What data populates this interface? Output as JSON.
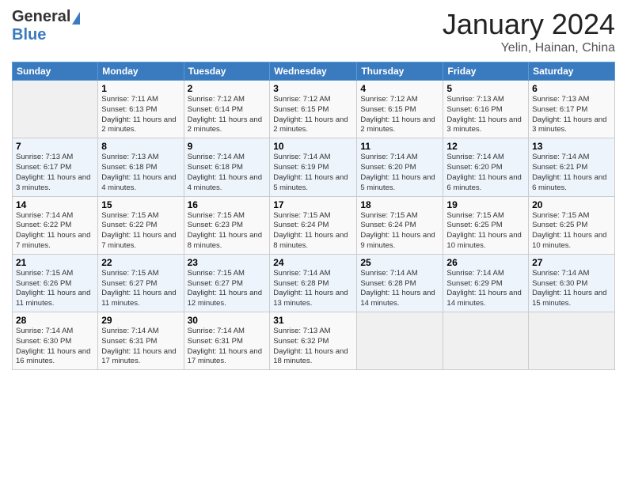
{
  "header": {
    "logo_general": "General",
    "logo_blue": "Blue",
    "month_year": "January 2024",
    "location": "Yelin, Hainan, China"
  },
  "days_of_week": [
    "Sunday",
    "Monday",
    "Tuesday",
    "Wednesday",
    "Thursday",
    "Friday",
    "Saturday"
  ],
  "weeks": [
    [
      {
        "num": "",
        "empty": true
      },
      {
        "num": "1",
        "sunrise": "7:11 AM",
        "sunset": "6:13 PM",
        "daylight": "11 hours and 2 minutes."
      },
      {
        "num": "2",
        "sunrise": "7:12 AM",
        "sunset": "6:14 PM",
        "daylight": "11 hours and 2 minutes."
      },
      {
        "num": "3",
        "sunrise": "7:12 AM",
        "sunset": "6:15 PM",
        "daylight": "11 hours and 2 minutes."
      },
      {
        "num": "4",
        "sunrise": "7:12 AM",
        "sunset": "6:15 PM",
        "daylight": "11 hours and 2 minutes."
      },
      {
        "num": "5",
        "sunrise": "7:13 AM",
        "sunset": "6:16 PM",
        "daylight": "11 hours and 3 minutes."
      },
      {
        "num": "6",
        "sunrise": "7:13 AM",
        "sunset": "6:17 PM",
        "daylight": "11 hours and 3 minutes."
      }
    ],
    [
      {
        "num": "7",
        "sunrise": "7:13 AM",
        "sunset": "6:17 PM",
        "daylight": "11 hours and 3 minutes."
      },
      {
        "num": "8",
        "sunrise": "7:13 AM",
        "sunset": "6:18 PM",
        "daylight": "11 hours and 4 minutes."
      },
      {
        "num": "9",
        "sunrise": "7:14 AM",
        "sunset": "6:18 PM",
        "daylight": "11 hours and 4 minutes."
      },
      {
        "num": "10",
        "sunrise": "7:14 AM",
        "sunset": "6:19 PM",
        "daylight": "11 hours and 5 minutes."
      },
      {
        "num": "11",
        "sunrise": "7:14 AM",
        "sunset": "6:20 PM",
        "daylight": "11 hours and 5 minutes."
      },
      {
        "num": "12",
        "sunrise": "7:14 AM",
        "sunset": "6:20 PM",
        "daylight": "11 hours and 6 minutes."
      },
      {
        "num": "13",
        "sunrise": "7:14 AM",
        "sunset": "6:21 PM",
        "daylight": "11 hours and 6 minutes."
      }
    ],
    [
      {
        "num": "14",
        "sunrise": "7:14 AM",
        "sunset": "6:22 PM",
        "daylight": "11 hours and 7 minutes."
      },
      {
        "num": "15",
        "sunrise": "7:15 AM",
        "sunset": "6:22 PM",
        "daylight": "11 hours and 7 minutes."
      },
      {
        "num": "16",
        "sunrise": "7:15 AM",
        "sunset": "6:23 PM",
        "daylight": "11 hours and 8 minutes."
      },
      {
        "num": "17",
        "sunrise": "7:15 AM",
        "sunset": "6:24 PM",
        "daylight": "11 hours and 8 minutes."
      },
      {
        "num": "18",
        "sunrise": "7:15 AM",
        "sunset": "6:24 PM",
        "daylight": "11 hours and 9 minutes."
      },
      {
        "num": "19",
        "sunrise": "7:15 AM",
        "sunset": "6:25 PM",
        "daylight": "11 hours and 10 minutes."
      },
      {
        "num": "20",
        "sunrise": "7:15 AM",
        "sunset": "6:25 PM",
        "daylight": "11 hours and 10 minutes."
      }
    ],
    [
      {
        "num": "21",
        "sunrise": "7:15 AM",
        "sunset": "6:26 PM",
        "daylight": "11 hours and 11 minutes."
      },
      {
        "num": "22",
        "sunrise": "7:15 AM",
        "sunset": "6:27 PM",
        "daylight": "11 hours and 11 minutes."
      },
      {
        "num": "23",
        "sunrise": "7:15 AM",
        "sunset": "6:27 PM",
        "daylight": "11 hours and 12 minutes."
      },
      {
        "num": "24",
        "sunrise": "7:14 AM",
        "sunset": "6:28 PM",
        "daylight": "11 hours and 13 minutes."
      },
      {
        "num": "25",
        "sunrise": "7:14 AM",
        "sunset": "6:28 PM",
        "daylight": "11 hours and 14 minutes."
      },
      {
        "num": "26",
        "sunrise": "7:14 AM",
        "sunset": "6:29 PM",
        "daylight": "11 hours and 14 minutes."
      },
      {
        "num": "27",
        "sunrise": "7:14 AM",
        "sunset": "6:30 PM",
        "daylight": "11 hours and 15 minutes."
      }
    ],
    [
      {
        "num": "28",
        "sunrise": "7:14 AM",
        "sunset": "6:30 PM",
        "daylight": "11 hours and 16 minutes."
      },
      {
        "num": "29",
        "sunrise": "7:14 AM",
        "sunset": "6:31 PM",
        "daylight": "11 hours and 17 minutes."
      },
      {
        "num": "30",
        "sunrise": "7:14 AM",
        "sunset": "6:31 PM",
        "daylight": "11 hours and 17 minutes."
      },
      {
        "num": "31",
        "sunrise": "7:13 AM",
        "sunset": "6:32 PM",
        "daylight": "11 hours and 18 minutes."
      },
      {
        "num": "",
        "empty": true
      },
      {
        "num": "",
        "empty": true
      },
      {
        "num": "",
        "empty": true
      }
    ]
  ],
  "labels": {
    "sunrise": "Sunrise:",
    "sunset": "Sunset:",
    "daylight": "Daylight:"
  }
}
